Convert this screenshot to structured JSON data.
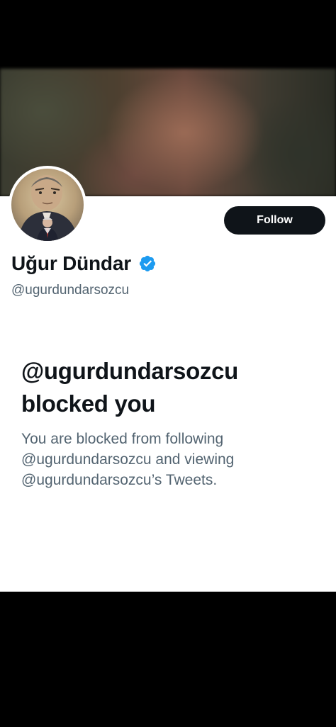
{
  "profile": {
    "display_name": "Uğur Dündar",
    "handle": "@ugurdundarsozcu",
    "follow_label": "Follow",
    "verified_icon": "verified-badge-icon",
    "accent_color": "#1d9bf0"
  },
  "blocked": {
    "title_line1": "@ugurdundarsozcu",
    "title_line2": "blocked you",
    "desc_line1": "You are blocked from following",
    "desc_line2": "@ugurdundarsozcu and viewing",
    "desc_line3": "@ugurdundarsozcu’s Tweets."
  }
}
